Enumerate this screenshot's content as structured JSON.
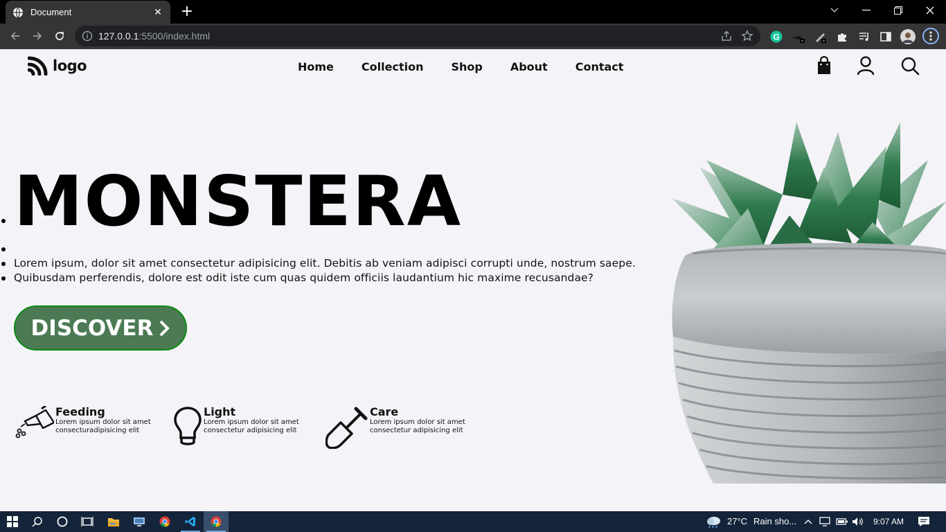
{
  "browser": {
    "tab_title": "Document",
    "url_host": "127.0.0.1",
    "url_rest": ":5500/index.html"
  },
  "site": {
    "logo_text": "logo",
    "nav": [
      "Home",
      "Collection",
      "Shop",
      "About",
      "Contact"
    ],
    "hero_title": "MONSTERA",
    "paragraphs": [
      "Lorem ipsum, dolor sit amet consectetur adipisicing elit. Debitis ab veniam adipisci corrupti unde, nostrum saepe.",
      "Quibusdam perferendis, dolore est odit iste cum quas quidem officiis laudantium hic maxime recusandae?"
    ],
    "cta_label": "DISCOVER",
    "features": [
      {
        "title": "Feeding",
        "desc": "Lorem ipsum dolor sit amet consecturadipisicing elit"
      },
      {
        "title": "Light",
        "desc": "Lorem ipsum dolor sit amet consectetur adipisicing elit"
      },
      {
        "title": "Care",
        "desc": "Lorem ipsum dolor sit amet consectetur adipisicing elit"
      }
    ],
    "accent_color": "#4b7a54"
  },
  "taskbar": {
    "weather": "27°C",
    "weather_desc": "Rain sho...",
    "time": "9:07 AM"
  }
}
